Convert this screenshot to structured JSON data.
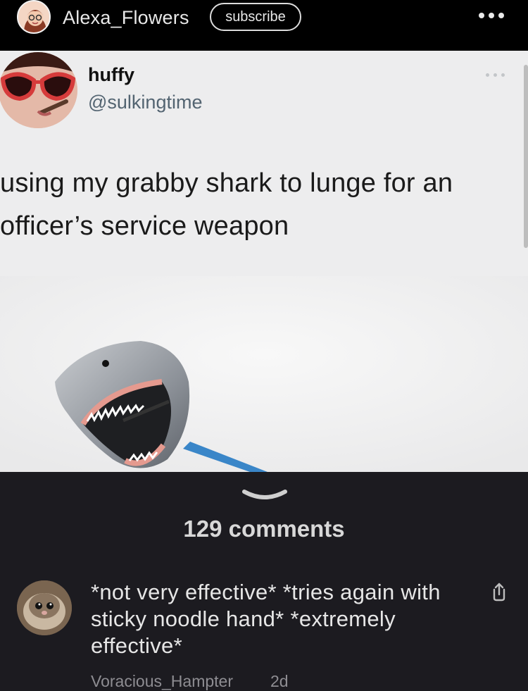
{
  "header": {
    "username": "Alexa_Flowers",
    "subscribe_label": "subscribe"
  },
  "tweet": {
    "name": "huffy",
    "handle": "@sulkingtime",
    "text": "using my grabby shark to lunge for an officer’s service weapon"
  },
  "comments": {
    "count_label": "129 comments",
    "items": [
      {
        "text": "*not very effective* *tries again with sticky noodle hand* *extremely effective*",
        "author": "Voracious_Hampter",
        "time": "2d"
      }
    ]
  },
  "icons": {
    "top_more": "more-dots-icon",
    "tweet_more": "more-dots-icon",
    "chevron": "chevron-down-icon",
    "share": "share-icon"
  },
  "colors": {
    "background": "#000000",
    "post_bg": "#ededee",
    "comments_bg": "#1c1b20",
    "handle": "#536471"
  }
}
